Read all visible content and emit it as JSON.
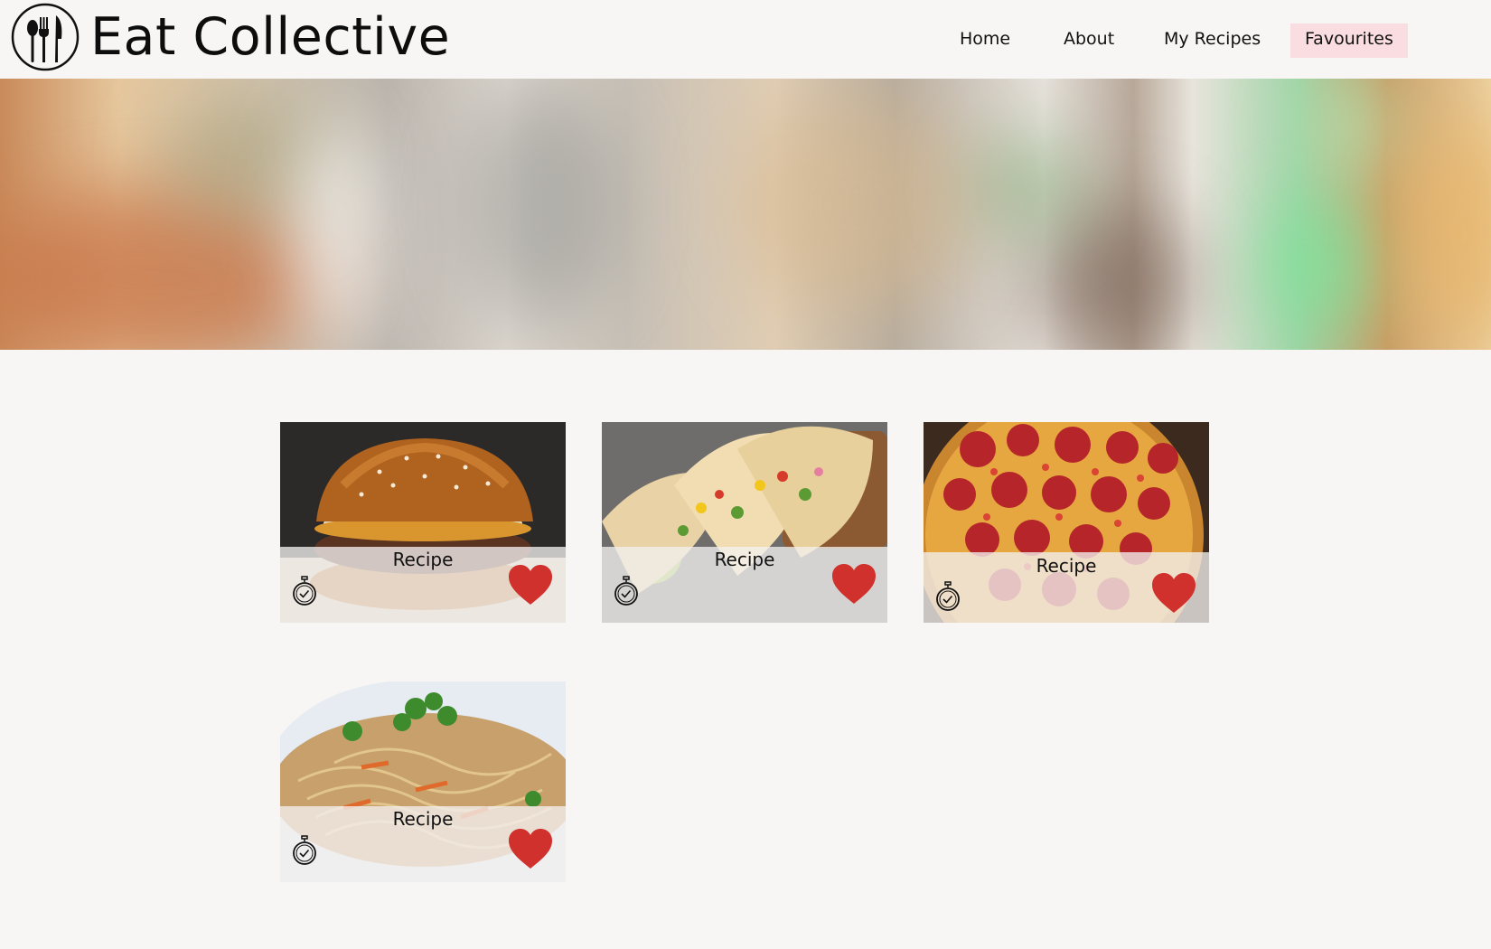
{
  "header": {
    "brand": "Eat Collective",
    "logo_icon": "cutlery-logo-icon"
  },
  "nav": {
    "items": [
      {
        "label": "Home",
        "active": false
      },
      {
        "label": "About",
        "active": false
      },
      {
        "label": "My Recipes",
        "active": false
      },
      {
        "label": "Favourites",
        "active": true
      }
    ]
  },
  "hero": {
    "image": "blurred-restaurant-background"
  },
  "recipes": [
    {
      "title": "Recipe",
      "image": "burger-photo",
      "favourited": true,
      "timer_icon": "stopwatch-icon",
      "heart_icon": "heart-icon"
    },
    {
      "title": "Recipe",
      "image": "tacos-photo",
      "favourited": true,
      "timer_icon": "stopwatch-icon",
      "heart_icon": "heart-icon"
    },
    {
      "title": "Recipe",
      "image": "pepperoni-pizza-photo",
      "favourited": true,
      "timer_icon": "stopwatch-icon",
      "heart_icon": "heart-icon"
    },
    {
      "title": "Recipe",
      "image": "stir-fry-noodles-photo",
      "favourited": true,
      "timer_icon": "stopwatch-icon",
      "heart_icon": "heart-icon"
    }
  ],
  "colors": {
    "background": "#f8f6f4",
    "nav_active": "#f9dde1",
    "heart": "#d0312d",
    "text": "#111111"
  }
}
